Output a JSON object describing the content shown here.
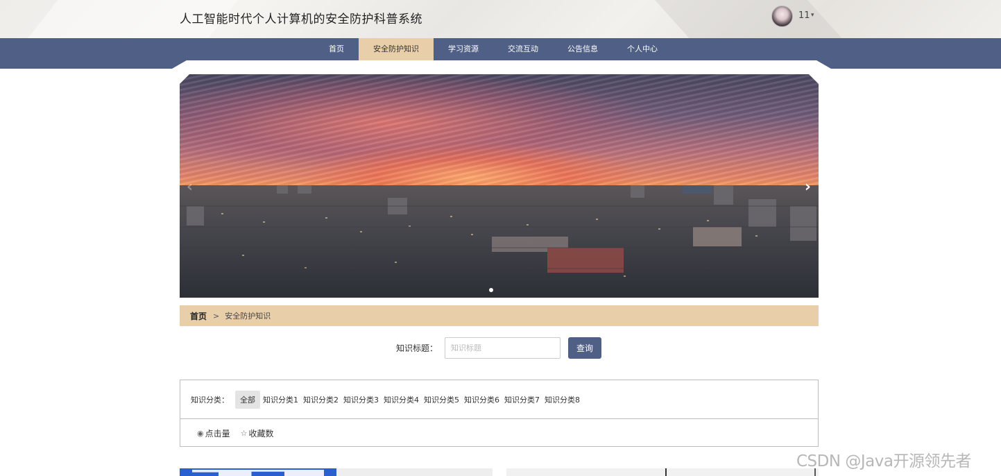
{
  "header": {
    "site_title": "人工智能时代个人计算机的安全防护科普系统",
    "username": "11",
    "user_menu_caret": "▾"
  },
  "nav": {
    "items": [
      {
        "label": "首页",
        "active": false
      },
      {
        "label": "安全防护知识",
        "active": true
      },
      {
        "label": "学习资源",
        "active": false
      },
      {
        "label": "交流互动",
        "active": false
      },
      {
        "label": "公告信息",
        "active": false
      },
      {
        "label": "个人中心",
        "active": false
      }
    ]
  },
  "carousel": {
    "prev_icon": "chevron-left-icon",
    "next_icon": "chevron-right-icon",
    "prev_glyph": "‹",
    "next_glyph": "›",
    "slide_count": 1,
    "active_slide": 1
  },
  "breadcrumb": {
    "home": "首页",
    "separator": ">",
    "current": "安全防护知识"
  },
  "search": {
    "label": "知识标题：",
    "placeholder": "知识标题",
    "value": "",
    "button_label": "查询"
  },
  "filter": {
    "label": "知识分类：",
    "categories": [
      "全部",
      "知识分类1",
      "知识分类2",
      "知识分类3",
      "知识分类4",
      "知识分类5",
      "知识分类6",
      "知识分类7",
      "知识分类8"
    ],
    "active": "全部"
  },
  "sort": {
    "clicks_label": "点击量",
    "clicks_icon": "eye-icon",
    "favorites_label": "收藏数",
    "favorites_icon": "star-outline-icon"
  },
  "watermark": "CSDN @Java开源领先者",
  "colors": {
    "nav_bg": "#4f5f85",
    "accent_tan": "#e9cfa9",
    "button_bg": "#4f5f85"
  }
}
